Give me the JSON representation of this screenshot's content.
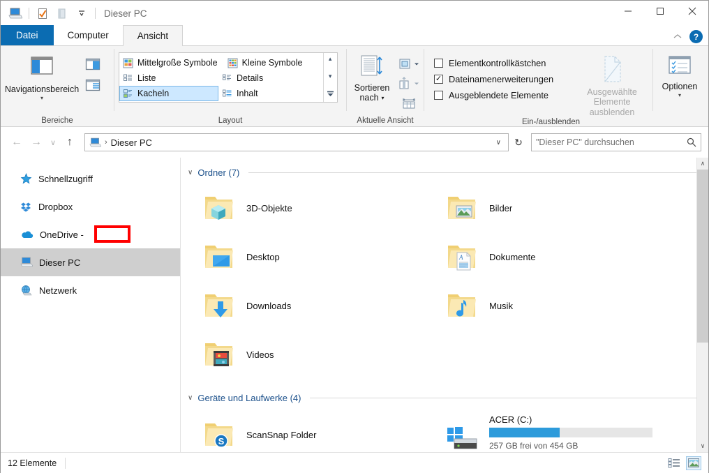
{
  "window": {
    "title": "Dieser PC",
    "quick_access": [
      {
        "name": "this-pc-icon",
        "label": "Dieser PC"
      },
      {
        "name": "properties-icon",
        "label": "Eigenschaften"
      },
      {
        "name": "new-folder-icon",
        "label": "Neuer Ordner"
      },
      {
        "name": "customize-qat-caret",
        "label": "Symbolleiste anpassen"
      }
    ],
    "controls": {
      "minimize": "—",
      "maximize": "☐",
      "close": "✕"
    }
  },
  "tabs": [
    {
      "label": "Datei",
      "state": "file"
    },
    {
      "label": "Computer",
      "state": "normal"
    },
    {
      "label": "Ansicht",
      "state": "active"
    }
  ],
  "tabsrow_right": {
    "collapse_ribbon": "⌃",
    "help": "?"
  },
  "ribbon": {
    "groups": [
      {
        "name": "bereiche",
        "label": "Bereiche",
        "big_button": {
          "label": "Navigationsbereich",
          "caret": "▾"
        },
        "small_buttons": [
          {
            "name": "preview-pane-icon",
            "label": "Vorschaufenster"
          },
          {
            "name": "details-pane-icon",
            "label": "Detailbereich"
          }
        ]
      },
      {
        "name": "layout",
        "label": "Layout",
        "items": [
          {
            "label": "Mittelgroße Symbole",
            "selected": false,
            "icon": "medium-icons-icon"
          },
          {
            "label": "Kleine Symbole",
            "selected": false,
            "icon": "small-icons-icon"
          },
          {
            "label": "Liste",
            "selected": false,
            "icon": "list-icon"
          },
          {
            "label": "Details",
            "selected": false,
            "icon": "details-icon"
          },
          {
            "label": "Kacheln",
            "selected": true,
            "icon": "tiles-icon"
          },
          {
            "label": "Inhalt",
            "selected": false,
            "icon": "content-icon"
          }
        ],
        "scroll": {
          "up": "▴",
          "down": "▾",
          "more": "≡"
        }
      },
      {
        "name": "aktuelle-ansicht",
        "label": "Aktuelle Ansicht",
        "big_button": {
          "label_line1": "Sortieren",
          "label_line2": "nach",
          "caret": "▾"
        },
        "small_buttons": [
          {
            "name": "group-by-icon",
            "label": "Gruppieren nach"
          },
          {
            "name": "add-columns-icon",
            "label": "Spalten hinzufügen"
          },
          {
            "name": "size-all-columns-icon",
            "label": "Alle Spalten anpassen"
          }
        ]
      },
      {
        "name": "ein-ausblenden",
        "label": "Ein-/ausblenden",
        "checkboxes": [
          {
            "label": "Elementkontrollkästchen",
            "checked": false
          },
          {
            "label": "Dateinamenerweiterungen",
            "checked": true
          },
          {
            "label": "Ausgeblendete Elemente",
            "checked": false
          }
        ],
        "big_button": {
          "label_line1": "Ausgewählte",
          "label_line2": "Elemente ausblenden",
          "disabled": true
        }
      },
      {
        "name": "optionen",
        "label": "",
        "big_button": {
          "label": "Optionen",
          "caret": "▾"
        }
      }
    ]
  },
  "addressbar": {
    "back": "←",
    "forward": "→",
    "recent": "∨",
    "up": "↑",
    "breadcrumb": {
      "icon": "this-pc-icon",
      "separator": "›",
      "path": "Dieser PC"
    },
    "dropdown_caret": "∨",
    "refresh": "↻",
    "search": {
      "placeholder": "\"Dieser PC\" durchsuchen",
      "value": "",
      "icon": "search-icon"
    }
  },
  "navpane": {
    "items": [
      {
        "label": "Schnellzugriff",
        "icon": "star-icon",
        "selected": false
      },
      {
        "label": "Dropbox",
        "icon": "dropbox-icon",
        "selected": false
      },
      {
        "label": "OneDrive - ",
        "icon": "onedrive-icon",
        "selected": false,
        "redacted": true
      },
      {
        "label": "Dieser PC",
        "icon": "this-pc-icon",
        "selected": true
      },
      {
        "label": "Netzwerk",
        "icon": "network-icon",
        "selected": false
      }
    ]
  },
  "content": {
    "sections": [
      {
        "name": "ordner",
        "title": "Ordner (7)",
        "chevron": "∨",
        "items": [
          {
            "label": "3D-Objekte",
            "icon": "folder-3d-objects-icon"
          },
          {
            "label": "Bilder",
            "icon": "folder-pictures-icon"
          },
          {
            "label": "Desktop",
            "icon": "folder-desktop-icon"
          },
          {
            "label": "Dokumente",
            "icon": "folder-documents-icon"
          },
          {
            "label": "Downloads",
            "icon": "folder-downloads-icon"
          },
          {
            "label": "Musik",
            "icon": "folder-music-icon"
          },
          {
            "label": "Videos",
            "icon": "folder-videos-icon"
          }
        ]
      },
      {
        "name": "geraete-und-laufwerke",
        "title": "Geräte und Laufwerke (4)",
        "chevron": "∨",
        "items": [
          {
            "label": "ScanSnap Folder",
            "icon": "folder-scansnap-icon"
          },
          {
            "label": "ACER (C:)",
            "icon": "drive-windows-icon",
            "free_text": "257 GB frei von 454 GB",
            "used_percent": 43,
            "bar_color": "#2d9bdb",
            "bar_track_color": "#e6e6e6"
          }
        ]
      }
    ],
    "scrollbar": {
      "up": "∧",
      "down": "∨",
      "thumb_percent": 64
    }
  },
  "statusbar": {
    "item_count": "12 Elemente",
    "views": [
      {
        "name": "details-view-toggle",
        "selected": false
      },
      {
        "name": "large-icons-view-toggle",
        "selected": true
      }
    ]
  },
  "colors": {
    "accent": "#0b6cb2",
    "tab_file": "#0b6cb2",
    "ribbon_bg": "#f4f4f4",
    "selection": "#cfcfcf",
    "section_header": "#1a4f8a",
    "redaction_border": "#ff0000"
  }
}
